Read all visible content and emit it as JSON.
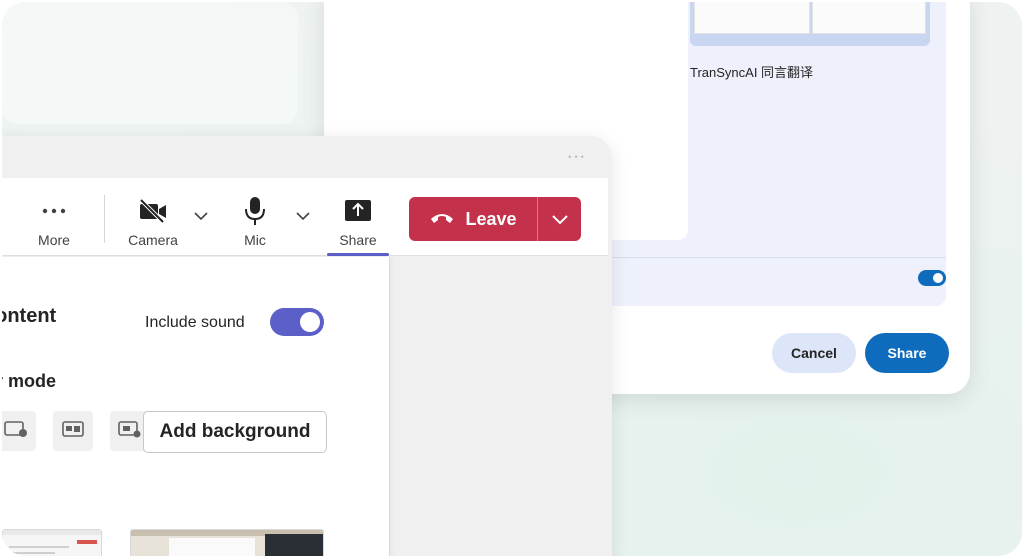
{
  "back_dialog": {
    "caption": "TranSyncAI 同言翻译",
    "cancel_label": "Cancel",
    "share_label": "Share",
    "toggle_on": true
  },
  "window_menu": "···",
  "toolbar": {
    "more_label": "More",
    "camera_label": "Camera",
    "mic_label": "Mic",
    "share_label": "Share",
    "leave_label": "Leave"
  },
  "share_panel": {
    "title": "content",
    "include_sound_label": "Include sound",
    "include_sound_on": true,
    "mode_title": "ter mode",
    "add_background_label": "Add background"
  },
  "colors": {
    "accent": "#5b5fc7",
    "leave": "#c4314b",
    "primary_blue": "#0f6cbd"
  },
  "icons": [
    "more-icon",
    "camera-off-icon",
    "mic-icon",
    "share-tray-icon",
    "phone-hangup-icon",
    "chevron-down-icon"
  ]
}
